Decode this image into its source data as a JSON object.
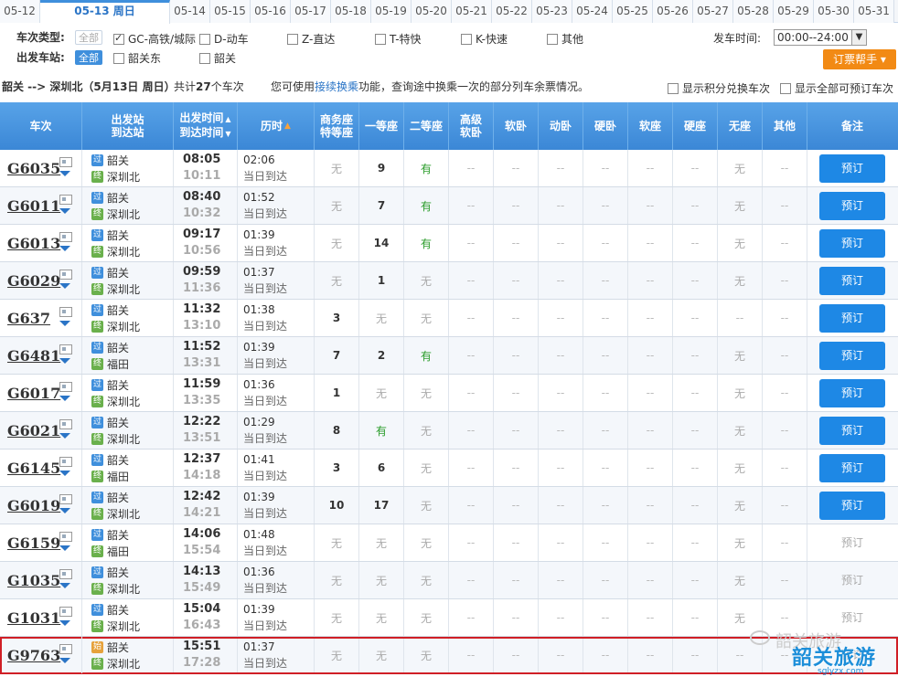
{
  "date_tabs": [
    "05-12",
    "05-13 周日",
    "05-14",
    "05-15",
    "05-16",
    "05-17",
    "05-18",
    "05-19",
    "05-20",
    "05-21",
    "05-22",
    "05-23",
    "05-24",
    "05-25",
    "05-26",
    "05-27",
    "05-28",
    "05-29",
    "05-30",
    "05-31"
  ],
  "filters": {
    "type_label": "车次类型:",
    "station_label": "出发车站:",
    "all_chip": "全部",
    "types": [
      {
        "label": "GC-高铁/城际",
        "checked": true
      },
      {
        "label": "D-动车",
        "checked": false
      },
      {
        "label": "Z-直达",
        "checked": false
      },
      {
        "label": "T-特快",
        "checked": false
      },
      {
        "label": "K-快速",
        "checked": false
      },
      {
        "label": "其他",
        "checked": false
      }
    ],
    "stations": [
      {
        "label": "韶关东",
        "checked": false
      },
      {
        "label": "韶关",
        "checked": false
      }
    ],
    "time_label": "发车时间:",
    "time_value": "00:00--24:00",
    "help_button": "订票帮手 ▾"
  },
  "summary": {
    "route": "韶关 --> 深圳北（5月13日  周日）",
    "total_prefix": "共计",
    "total_count": "27",
    "total_suffix": "个车次",
    "hint_pre": "您可使用",
    "hint_link": "接续换乘",
    "hint_post": "功能，查询途中换乘一次的部分列车余票情况。",
    "option1": "显示积分兑换车次",
    "option2": "显示全部可预订车次"
  },
  "columns": {
    "train": "车次",
    "station": [
      "出发站",
      "到达站"
    ],
    "time": [
      "出发时间",
      "到达时间"
    ],
    "duration": "历时",
    "business": [
      "商务座",
      "特等座"
    ],
    "first": "一等座",
    "second": "二等座",
    "premium_soft": [
      "高级",
      "软卧"
    ],
    "soft_sleeper": "软卧",
    "moving_sleeper": "动卧",
    "hard_sleeper": "硬卧",
    "soft_seat": "软座",
    "hard_seat": "硬座",
    "no_seat": "无座",
    "other": "其他",
    "note": "备注"
  },
  "rows": [
    {
      "train": "G6035",
      "from": "韶关",
      "to": "深圳北",
      "dep": "08:05",
      "arr": "10:11",
      "dur": "02:06",
      "note": "当日到达",
      "seats": [
        "无",
        "9",
        "有",
        "--",
        "--",
        "--",
        "--",
        "--",
        "--",
        "无",
        "--"
      ],
      "book": "预订",
      "bookable": true
    },
    {
      "train": "G6011",
      "from": "韶关",
      "to": "深圳北",
      "dep": "08:40",
      "arr": "10:32",
      "dur": "01:52",
      "note": "当日到达",
      "seats": [
        "无",
        "7",
        "有",
        "--",
        "--",
        "--",
        "--",
        "--",
        "--",
        "无",
        "--"
      ],
      "book": "预订",
      "bookable": true
    },
    {
      "train": "G6013",
      "from": "韶关",
      "to": "深圳北",
      "dep": "09:17",
      "arr": "10:56",
      "dur": "01:39",
      "note": "当日到达",
      "seats": [
        "无",
        "14",
        "有",
        "--",
        "--",
        "--",
        "--",
        "--",
        "--",
        "无",
        "--"
      ],
      "book": "预订",
      "bookable": true
    },
    {
      "train": "G6029",
      "from": "韶关",
      "to": "深圳北",
      "dep": "09:59",
      "arr": "11:36",
      "dur": "01:37",
      "note": "当日到达",
      "seats": [
        "无",
        "1",
        "无",
        "--",
        "--",
        "--",
        "--",
        "--",
        "--",
        "无",
        "--"
      ],
      "book": "预订",
      "bookable": true
    },
    {
      "train": "G637",
      "from": "韶关",
      "to": "深圳北",
      "dep": "11:32",
      "arr": "13:10",
      "dur": "01:38",
      "note": "当日到达",
      "seats": [
        "3",
        "无",
        "无",
        "--",
        "--",
        "--",
        "--",
        "--",
        "--",
        "--",
        "--"
      ],
      "book": "预订",
      "bookable": true
    },
    {
      "train": "G6481",
      "from": "韶关",
      "to": "福田",
      "dep": "11:52",
      "arr": "13:31",
      "dur": "01:39",
      "note": "当日到达",
      "seats": [
        "7",
        "2",
        "有",
        "--",
        "--",
        "--",
        "--",
        "--",
        "--",
        "无",
        "--"
      ],
      "book": "预订",
      "bookable": true
    },
    {
      "train": "G6017",
      "from": "韶关",
      "to": "深圳北",
      "dep": "11:59",
      "arr": "13:35",
      "dur": "01:36",
      "note": "当日到达",
      "seats": [
        "1",
        "无",
        "无",
        "--",
        "--",
        "--",
        "--",
        "--",
        "--",
        "无",
        "--"
      ],
      "book": "预订",
      "bookable": true
    },
    {
      "train": "G6021",
      "from": "韶关",
      "to": "深圳北",
      "dep": "12:22",
      "arr": "13:51",
      "dur": "01:29",
      "note": "当日到达",
      "seats": [
        "8",
        "有",
        "无",
        "--",
        "--",
        "--",
        "--",
        "--",
        "--",
        "无",
        "--"
      ],
      "book": "预订",
      "bookable": true
    },
    {
      "train": "G6145",
      "from": "韶关",
      "to": "福田",
      "dep": "12:37",
      "arr": "14:18",
      "dur": "01:41",
      "note": "当日到达",
      "seats": [
        "3",
        "6",
        "无",
        "--",
        "--",
        "--",
        "--",
        "--",
        "--",
        "无",
        "--"
      ],
      "book": "预订",
      "bookable": true
    },
    {
      "train": "G6019",
      "from": "韶关",
      "to": "深圳北",
      "dep": "12:42",
      "arr": "14:21",
      "dur": "01:39",
      "note": "当日到达",
      "seats": [
        "10",
        "17",
        "无",
        "--",
        "--",
        "--",
        "--",
        "--",
        "--",
        "无",
        "--"
      ],
      "book": "预订",
      "bookable": true
    },
    {
      "train": "G6159",
      "from": "韶关",
      "to": "福田",
      "dep": "14:06",
      "arr": "15:54",
      "dur": "01:48",
      "note": "当日到达",
      "seats": [
        "无",
        "无",
        "无",
        "--",
        "--",
        "--",
        "--",
        "--",
        "--",
        "无",
        "--"
      ],
      "book": "预订",
      "bookable": false
    },
    {
      "train": "G1035",
      "from": "韶关",
      "to": "深圳北",
      "dep": "14:13",
      "arr": "15:49",
      "dur": "01:36",
      "note": "当日到达",
      "seats": [
        "无",
        "无",
        "无",
        "--",
        "--",
        "--",
        "--",
        "--",
        "--",
        "无",
        "--"
      ],
      "book": "预订",
      "bookable": false
    },
    {
      "train": "G1031",
      "from": "韶关",
      "to": "深圳北",
      "dep": "15:04",
      "arr": "16:43",
      "dur": "01:39",
      "note": "当日到达",
      "seats": [
        "无",
        "无",
        "无",
        "--",
        "--",
        "--",
        "--",
        "--",
        "--",
        "无",
        "--"
      ],
      "book": "预订",
      "bookable": false
    },
    {
      "train": "G9763",
      "from": "韶关",
      "to": "深圳北",
      "dep": "15:51",
      "arr": "17:28",
      "dur": "01:37",
      "note": "当日到达",
      "seats": [
        "无",
        "无",
        "无",
        "--",
        "--",
        "--",
        "--",
        "--",
        "--",
        "--",
        "--"
      ],
      "book": "预订",
      "bookable": false,
      "highlight": true,
      "from_badge": "始"
    }
  ],
  "watermark": {
    "line1": "韶关旅游",
    "line2": "韶关旅游",
    "site": "sglyzx.com"
  },
  "colors": {
    "header_blue": "#3b87d6",
    "book_blue": "#1e88e5",
    "highlight_red": "#d01f26",
    "available_green": "#2a9c2a",
    "help_orange": "#f28a14"
  }
}
